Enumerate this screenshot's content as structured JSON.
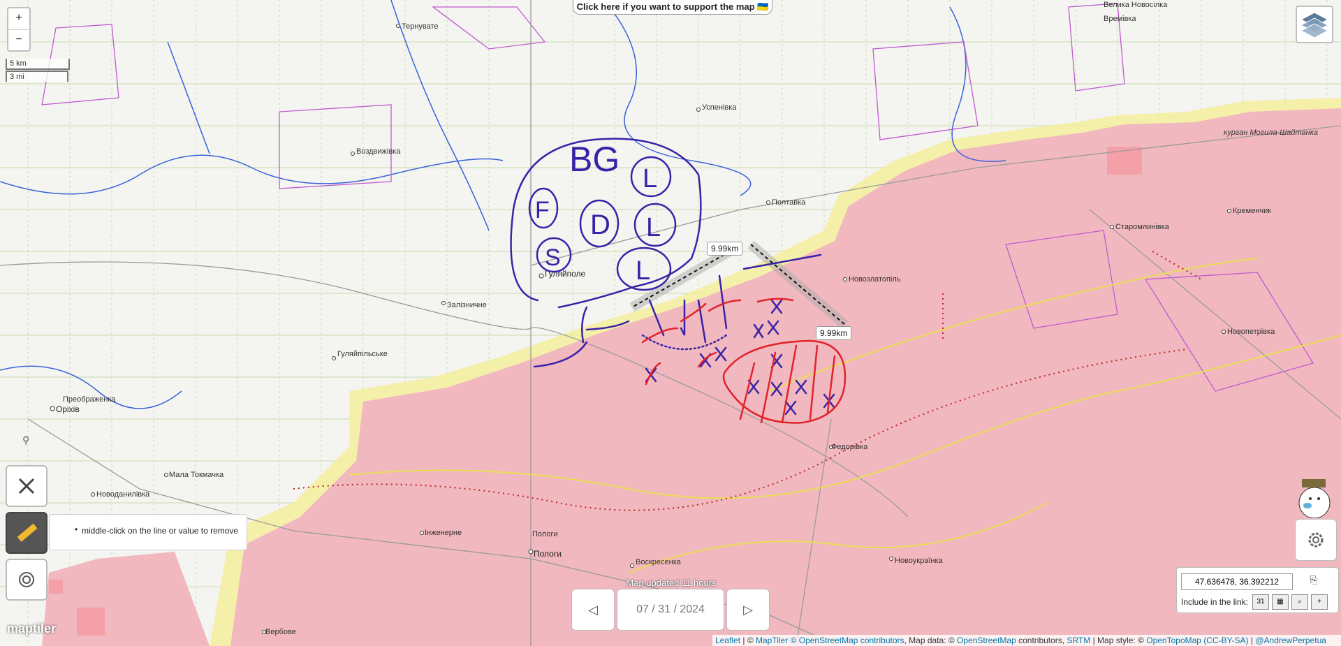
{
  "controls": {
    "zoom_in": "+",
    "zoom_out": "−",
    "scale_km": "5 km",
    "scale_mi": "3 mi",
    "support_text": "Click here if you want to support the map 🇺🇦",
    "tip_text": "middle-click on the line or value to remove",
    "map_updated": "Map updated 11 hours ago",
    "date_value": "07 / 31 / 2024",
    "coords_value": "47.636478, 36.392212",
    "include_link": "Include in the link:",
    "calendar_day": "31"
  },
  "measurements": [
    "9.99km",
    "9.99km"
  ],
  "places": [
    {
      "name": "Тернувате"
    },
    {
      "name": "Велика Новосілка"
    },
    {
      "name": "Времівка"
    },
    {
      "name": "Успенівка"
    },
    {
      "name": "Воздвижівка"
    },
    {
      "name": "Полтавка"
    },
    {
      "name": "курган Могила-Шайтанка"
    },
    {
      "name": "Кременчик"
    },
    {
      "name": "Старомлинівка"
    },
    {
      "name": "Новозлатопіль"
    },
    {
      "name": "Гуляйполе"
    },
    {
      "name": "Залізничне"
    },
    {
      "name": "Гуляйпільське"
    },
    {
      "name": "Новопетрівка"
    },
    {
      "name": "Преображенка"
    },
    {
      "name": "Оріхів"
    },
    {
      "name": "Федорівка"
    },
    {
      "name": "Мала Токмачка"
    },
    {
      "name": "Новоданилівка"
    },
    {
      "name": "Інженерне"
    },
    {
      "name": "Пологи"
    },
    {
      "name": "Пологи"
    },
    {
      "name": "Воскресенка"
    },
    {
      "name": "Новоукраїнка"
    },
    {
      "name": "Вербове"
    }
  ],
  "annotations": [
    "BG",
    "F",
    "D",
    "L",
    "L",
    "S",
    "L"
  ],
  "attribution": {
    "leaflet": "Leaflet",
    "sep1": " | © ",
    "maptiler": "MapTiler",
    "osm": "© OpenStreetMap contributors",
    "mapdata": ", Map data: © ",
    "osm2": "OpenStreetMap",
    "contrib": " contributors, ",
    "srtm": "SRTM",
    "mapstyle": " | Map style: © ",
    "otm": "OpenTopoMap",
    "ccbysa": "(CC-BY-SA)",
    "author": "@AndrewPerpetua"
  },
  "logo": "maptiler",
  "colors": {
    "occupied": "#f2b8bf",
    "contested": "#f3ee9c",
    "drawing_blue": "#3a22a8",
    "drawing_red": "#e0242a",
    "roads": "#aaaaaa",
    "rivers": "#3a62d9",
    "borders": "#c05ad0"
  }
}
